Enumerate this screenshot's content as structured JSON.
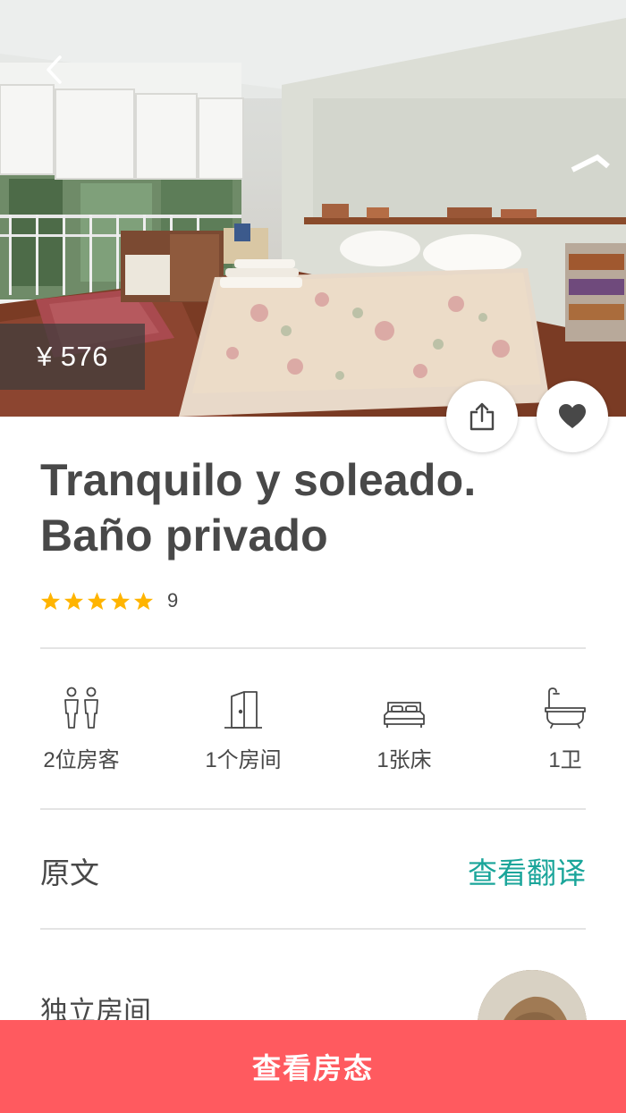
{
  "listing": {
    "price": "¥ 576",
    "title_line1": "Tranquilo y soleado.",
    "title_line2": "Baño privado",
    "rating_stars": 5,
    "review_count": "9"
  },
  "icons": {
    "back": "chevron-left-icon",
    "share": "share-icon",
    "favorite": "heart-icon",
    "star": "star-icon",
    "guests": "guests-icon",
    "rooms": "door-icon",
    "beds": "bed-icon",
    "baths": "bathtub-icon"
  },
  "amenities": {
    "guests": "2位房客",
    "rooms": "1个房间",
    "beds": "1张床",
    "baths": "1卫"
  },
  "description": {
    "original_label": "原文",
    "translate_link": "查看翻译"
  },
  "room": {
    "type": "独立房间"
  },
  "cta": {
    "label": "查看房态"
  },
  "colors": {
    "accent": "#ff5a5f",
    "link": "#1aa59a",
    "star": "#ffb400",
    "text": "#484848"
  }
}
